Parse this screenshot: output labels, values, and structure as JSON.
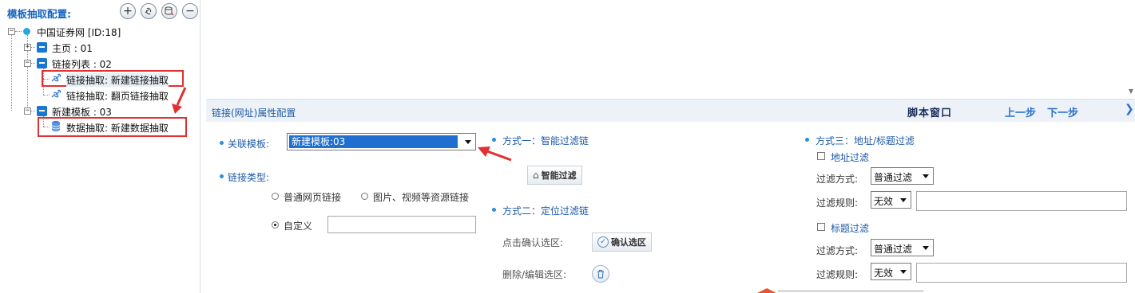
{
  "left_panel": {
    "title": "模板抽取配置:",
    "toolbar": {
      "add_label": "+",
      "remove_label": "−"
    },
    "tree": {
      "root": "中国证券网 [ID:18]",
      "nodes": [
        "主页 : 01",
        "链接列表 : 02",
        "链接抽取: 新建链接抽取",
        "链接抽取: 翻页链接抽取",
        "新建模板 : 03",
        "数据抽取: 新建数据抽取"
      ]
    }
  },
  "section": {
    "title": "链接(网址)属性配置",
    "script_window": "脚本窗口",
    "prev_step": "上一步",
    "next_step": "下一步"
  },
  "form": {
    "assoc_template_label": "关联模板:",
    "assoc_template_value": "新建模板:03",
    "link_type_label": "链接类型:",
    "radio_normal": "普通网页链接",
    "radio_resource": "图片、视频等资源链接",
    "radio_custom": "自定义",
    "custom_value": "",
    "method1_label": "方式一：智能过滤链",
    "smart_filter_btn": "智能过滤",
    "method2_label": "方式二：定位过滤链",
    "confirm_region_label": "点击确认选区:",
    "confirm_region_btn": "确认选区",
    "delete_edit_label": "删除/编辑选区:",
    "method3_label": "方式三：地址/标题过滤",
    "address_filter": {
      "checkbox_label": "地址过滤",
      "mode_label": "过滤方式:",
      "mode_value": "普通过滤",
      "rule_label": "过滤规则:",
      "rule_value": "无效",
      "rule_text": ""
    },
    "title_filter": {
      "checkbox_label": "标题过滤",
      "mode_label": "过滤方式:",
      "mode_value": "普通过滤",
      "rule_label": "过滤规则:",
      "rule_value": "无效",
      "rule_text": ""
    }
  },
  "colors": {
    "accent": "#1e5aa8",
    "highlight": "#e03030",
    "selected": "#1f6fd0"
  }
}
